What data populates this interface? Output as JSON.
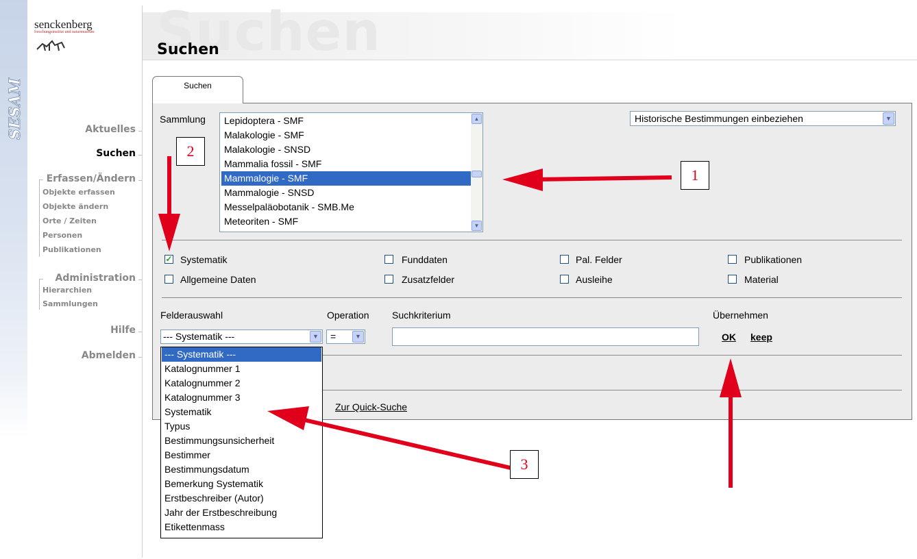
{
  "brand": {
    "name": "senckenberg",
    "tagline": "forschungsinstitut und naturmuseum",
    "app_name": "SESAM"
  },
  "header": {
    "ghost_title": "Suchen",
    "title": "Suchen"
  },
  "nav": {
    "aktuelles": "Aktuelles",
    "suchen": "Suchen",
    "erfassen": "Erfassen/Ändern",
    "erfassen_items": [
      "Objekte erfassen",
      "Objekte ändern",
      "Orte / Zeiten",
      "Personen",
      "Publikationen"
    ],
    "administration": "Administration",
    "administration_items": [
      "Hierarchien",
      "Sammlungen"
    ],
    "hilfe": "Hilfe",
    "abmelden": "Abmelden"
  },
  "tab": {
    "label": "Suchen"
  },
  "sammlung": {
    "label": "Sammlung",
    "items": [
      "Lepidoptera - SMF",
      "Malakologie - SMF",
      "Malakologie - SNSD",
      "Mammalia fossil - SMF",
      "Mammalogie - SMF",
      "Mammalogie - SNSD",
      "Messelpaläobotanik - SMB.Me",
      "Meteoriten - SMF"
    ],
    "selected": "Mammalogie - SMF"
  },
  "historische": {
    "value": "Historische Bestimmungen einbeziehen"
  },
  "checkboxes": {
    "systematik": {
      "label": "Systematik",
      "checked": true
    },
    "funddaten": {
      "label": "Funddaten",
      "checked": false
    },
    "pal_felder": {
      "label": "Pal. Felder",
      "checked": false
    },
    "publikationen": {
      "label": "Publikationen",
      "checked": false
    },
    "allgemeine": {
      "label": "Allgemeine Daten",
      "checked": false
    },
    "zusatzfelder": {
      "label": "Zusatzfelder",
      "checked": false
    },
    "ausleihe": {
      "label": "Ausleihe",
      "checked": false
    },
    "material": {
      "label": "Material",
      "checked": false
    }
  },
  "fields": {
    "felderauswahl_label": "Felderauswahl",
    "operation_label": "Operation",
    "suchkriterium_label": "Suchkriterium",
    "uebernehmen_label": "Übernehmen",
    "felderauswahl_value": "--- Systematik ---",
    "operation_value": "=",
    "suchkriterium_value": "",
    "ok_label": "OK",
    "keep_label": "keep"
  },
  "dropdown": {
    "options": [
      "--- Systematik ---",
      "Katalognummer 1",
      "Katalognummer 2",
      "Katalognummer 3",
      "Systematik",
      "Typus",
      "Bestimmungsunsicherheit",
      "Bestimmer",
      "Bestimmungsdatum",
      "Bemerkung Systematik",
      "Erstbeschreiber (Autor)",
      "Jahr der Erstbeschreibung",
      "Etikettenmass"
    ],
    "selected": "--- Systematik ---"
  },
  "quick_search_label": "Zur Quick-Suche",
  "callouts": {
    "one": "1",
    "two": "2",
    "three": "3"
  },
  "colors": {
    "annotation_red": "#e0001b",
    "selection_blue": "#316ac5",
    "panel_gray": "#ececec"
  }
}
